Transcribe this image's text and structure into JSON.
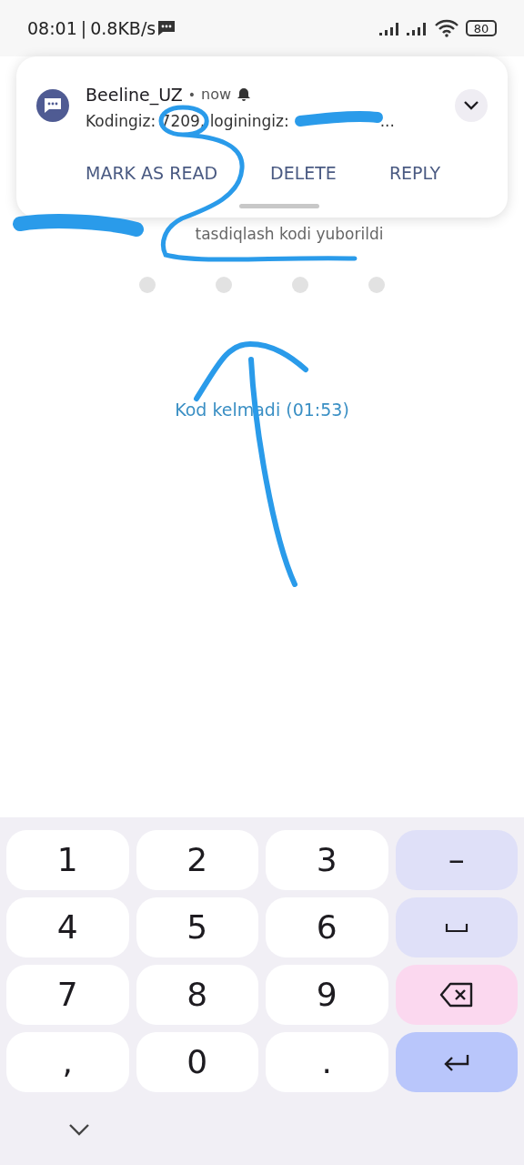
{
  "status_bar": {
    "time": "08:01",
    "separator": "|",
    "speed": "0.8KB/s",
    "battery": "80"
  },
  "notification": {
    "app": "Beeline_UZ",
    "dot": "•",
    "time": "now",
    "message": "Kodingiz: 7209, loginingiz:",
    "ellipsis": "...",
    "actions": [
      "MARK AS READ",
      "DELETE",
      "REPLY"
    ]
  },
  "page": {
    "sent_text": "tasdiqlash kodi yuborildi",
    "code_slots": [
      {
        "filled": false
      },
      {
        "filled": false
      },
      {
        "filled": false
      },
      {
        "filled": false
      }
    ],
    "resend_link": "Kod kelmadi (01:53)"
  },
  "keyboard": {
    "keys": [
      {
        "kind": "char",
        "label": "1"
      },
      {
        "kind": "char",
        "label": "2"
      },
      {
        "kind": "char",
        "label": "3"
      },
      {
        "kind": "function",
        "label": "–"
      },
      {
        "kind": "char",
        "label": "4"
      },
      {
        "kind": "char",
        "label": "5"
      },
      {
        "kind": "char",
        "label": "6"
      },
      {
        "kind": "space"
      },
      {
        "kind": "char",
        "label": "7"
      },
      {
        "kind": "char",
        "label": "8"
      },
      {
        "kind": "char",
        "label": "9"
      },
      {
        "kind": "backspace"
      },
      {
        "kind": "char",
        "label": ","
      },
      {
        "kind": "char",
        "label": "0"
      },
      {
        "kind": "char",
        "label": "."
      },
      {
        "kind": "enter"
      }
    ]
  }
}
